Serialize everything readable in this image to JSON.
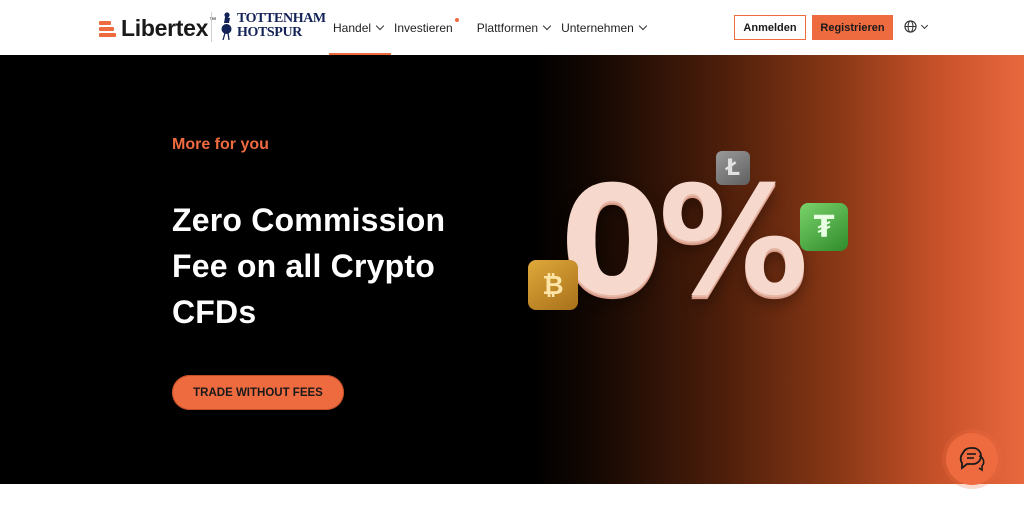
{
  "header": {
    "logo_text": "Libertex",
    "logo_tm": "™",
    "partner_line1": "TOTTENHAM",
    "partner_line2": "HOTSPUR",
    "nav": [
      {
        "label": "Handel",
        "has_dropdown": true,
        "active": true
      },
      {
        "label": "Investieren",
        "has_dropdown": false,
        "dot": true
      },
      {
        "label": "Plattformen",
        "has_dropdown": true
      },
      {
        "label": "Unternehmen",
        "has_dropdown": true
      }
    ],
    "login_label": "Anmelden",
    "register_label": "Registrieren",
    "language_icon": "globe-icon"
  },
  "hero": {
    "kicker": "More for you",
    "headline": "Zero Commission Fee on all Crypto CFDs",
    "cta_label": "TRADE WITHOUT FEES",
    "artwork": {
      "big_text": "0%",
      "coins": [
        "litecoin",
        "tether",
        "bitcoin"
      ]
    }
  },
  "chat": {
    "icon": "chat-icon"
  },
  "colors": {
    "accent": "#ee6a3f",
    "hero_bg": "#000000",
    "text_dark": "#1a1a1a",
    "spurs_navy": "#132257"
  }
}
